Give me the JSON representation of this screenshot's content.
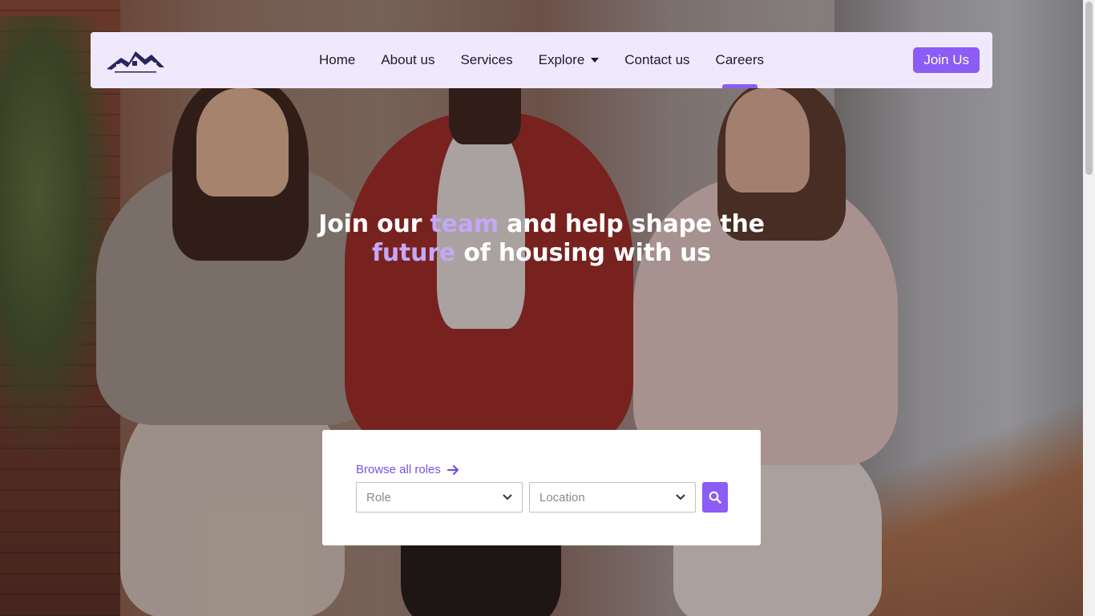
{
  "nav": {
    "logo_icon": "house-roofs-logo",
    "items": [
      {
        "label": "Home"
      },
      {
        "label": "About us"
      },
      {
        "label": "Services"
      },
      {
        "label": "Explore",
        "has_dropdown": true
      },
      {
        "label": "Contact us"
      },
      {
        "label": "Careers",
        "active": true
      }
    ],
    "cta_label": "Join Us"
  },
  "hero": {
    "title_part1": "Join our ",
    "title_accent1": "team",
    "title_part2": " and help shape the",
    "title_accent2": "future",
    "title_part3": " of housing with us"
  },
  "search": {
    "browse_label": "Browse all roles",
    "role_placeholder": "Role",
    "location_placeholder": "Location",
    "search_icon": "search-icon"
  },
  "colors": {
    "accent": "#8b5cf6",
    "accent_light": "#c4a7f7",
    "nav_bg": "#efe9fb",
    "logo": "#2a2560"
  }
}
